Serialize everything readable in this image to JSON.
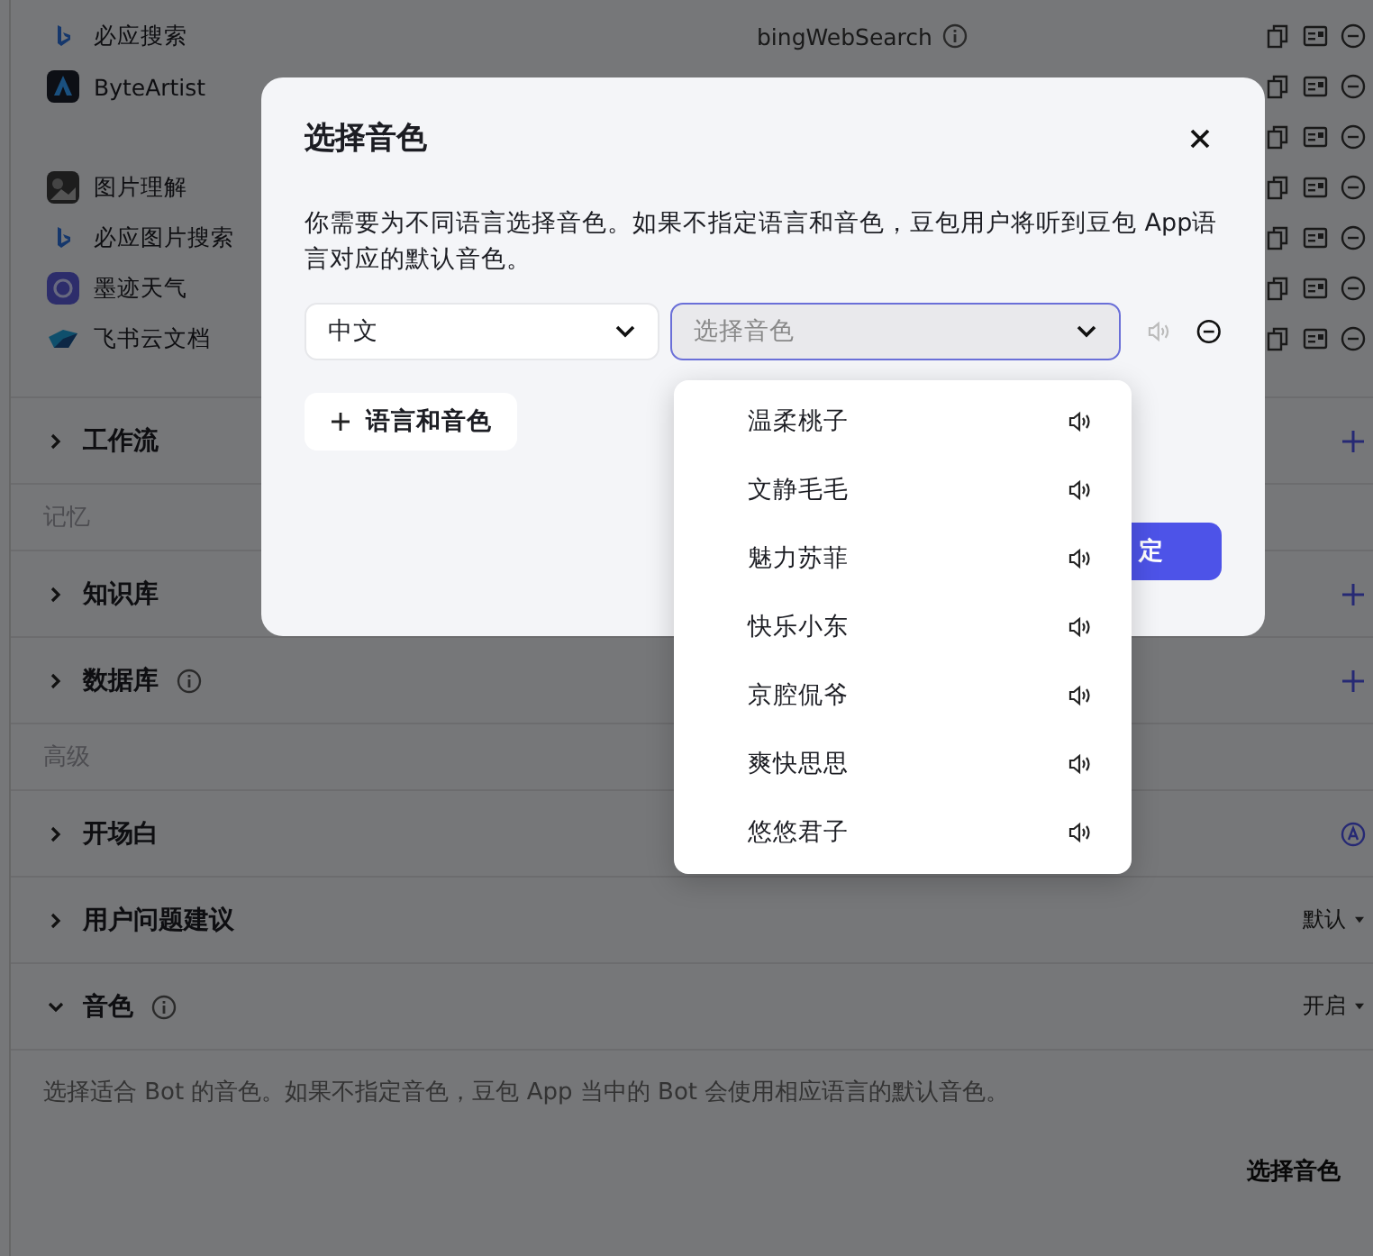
{
  "plugins": [
    {
      "kind": "plugin",
      "name": "必应搜索",
      "tool": "bingWebSearch",
      "tool_info": true
    },
    {
      "kind": "plugin",
      "name": "ByteArtist"
    },
    {
      "kind": "actions_only"
    },
    {
      "kind": "plugin",
      "name": "图片理解"
    },
    {
      "kind": "plugin",
      "name": "必应图片搜索"
    },
    {
      "kind": "plugin",
      "name": "墨迹天气"
    },
    {
      "kind": "plugin",
      "name": "飞书云文档"
    }
  ],
  "sections": [
    {
      "kind": "section",
      "title": "工作流",
      "expanded": false,
      "right": {
        "kind": "plus"
      }
    },
    {
      "kind": "group",
      "title": "记忆"
    },
    {
      "kind": "section",
      "title": "知识库",
      "expanded": false,
      "right": {
        "kind": "plus"
      }
    },
    {
      "kind": "section",
      "title": "数据库",
      "expanded": false,
      "info": true,
      "right": {
        "kind": "plus"
      }
    },
    {
      "kind": "group",
      "title": "高级"
    },
    {
      "kind": "section",
      "title": "开场白",
      "expanded": false,
      "right": {
        "kind": "auto"
      }
    },
    {
      "kind": "section",
      "title": "用户问题建议",
      "expanded": false,
      "right": {
        "kind": "dropdown",
        "text": "默认"
      }
    },
    {
      "kind": "section",
      "title": "音色",
      "expanded": true,
      "info": true,
      "right": {
        "kind": "dropdown",
        "text": "开启"
      }
    },
    {
      "kind": "description",
      "title": "选择适合 Bot 的音色。如果不指定音色，豆包 App 当中的 Bot 会使用相应语言的默认音色。"
    },
    {
      "kind": "action",
      "title": "选择音色"
    }
  ],
  "dialog": {
    "title": "选择音色",
    "description": "你需要为不同语言选择音色。如果不指定语言和音色，豆包用户将听到豆包 App语言对应的默认音色。",
    "language": {
      "value": "中文"
    },
    "voice": {
      "placeholder": "选择音色",
      "focused": true
    },
    "add_button": "语言和音色",
    "confirm_button": "定"
  },
  "voice_options": [
    {
      "label": "温柔桃子",
      "selected": false
    },
    {
      "label": "文静毛毛",
      "selected": false
    },
    {
      "label": "魅力苏菲",
      "selected": false
    },
    {
      "label": "快乐小东",
      "selected": false
    },
    {
      "label": "京腔侃爷",
      "selected": false
    },
    {
      "label": "爽快思思",
      "selected": false
    },
    {
      "label": "悠悠君子",
      "selected": false
    }
  ]
}
